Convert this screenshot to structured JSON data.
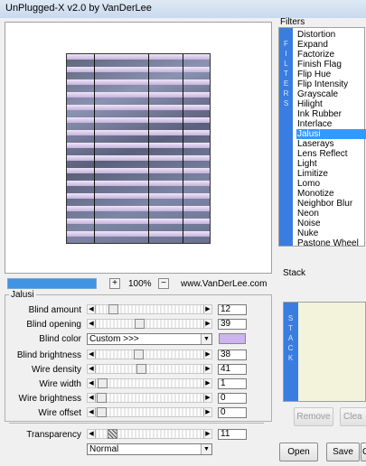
{
  "window": {
    "title": "UnPlugged-X v2.0 by VanDerLee"
  },
  "preview": {
    "zoom": "100%",
    "zoom_in": "+",
    "zoom_out": "−",
    "website": "www.VanDerLee.com",
    "progress": 1.0
  },
  "filter_group": {
    "title": "Jalusi",
    "rows": [
      {
        "label": "Blind amount",
        "value": "12",
        "slider_fraction": 0.12
      },
      {
        "label": "Blind opening",
        "value": "39",
        "slider_fraction": 0.39
      },
      {
        "label": "Blind brightness",
        "value": "38",
        "slider_fraction": 0.38
      },
      {
        "label": "Wire density",
        "value": "41",
        "slider_fraction": 0.41
      },
      {
        "label": "Wire width",
        "value": "1",
        "slider_fraction": 0.01
      },
      {
        "label": "Wire brightness",
        "value": "0",
        "slider_fraction": 0.0
      },
      {
        "label": "Wire offset",
        "value": "0",
        "slider_fraction": 0.0
      }
    ],
    "color": {
      "label": "Blind color",
      "selected": "Custom >>>",
      "swatch": "#cdb3f0"
    },
    "transparency": {
      "label": "Transparency",
      "value": "11",
      "slider_fraction": 0.11
    },
    "blend_mode": "Normal"
  },
  "filters": {
    "title": "Filters",
    "strip_letters": [
      "F",
      "I",
      "L",
      "T",
      "E",
      "R",
      "S"
    ],
    "items": [
      "Distortion",
      "Expand",
      "Factorize",
      "Finish Flag",
      "Flip Hue",
      "Flip Intensity",
      "Grayscale",
      "Hilight",
      "Ink Rubber",
      "Interlace",
      "Jalusi",
      "Laserays",
      "Lens Reflect",
      "Light",
      "Limitize",
      "Lomo",
      "Monotize",
      "Neighbor Blur",
      "Neon",
      "Noise",
      "Nuke",
      "Pastone Wheel"
    ],
    "selected": "Jalusi"
  },
  "stack": {
    "title": "Stack",
    "strip_letters": [
      "S",
      "T",
      "A",
      "C",
      "K"
    ],
    "remove_label": "Remove",
    "clear_label": "Clea"
  },
  "actions": {
    "open_label": "Open",
    "save_label": "Save",
    "third_label": "C"
  },
  "colors": {
    "accent": "#3a7de0",
    "selection": "#3399ff",
    "progress": "#3f94e4",
    "stack_bg": "#f3f3dc"
  }
}
